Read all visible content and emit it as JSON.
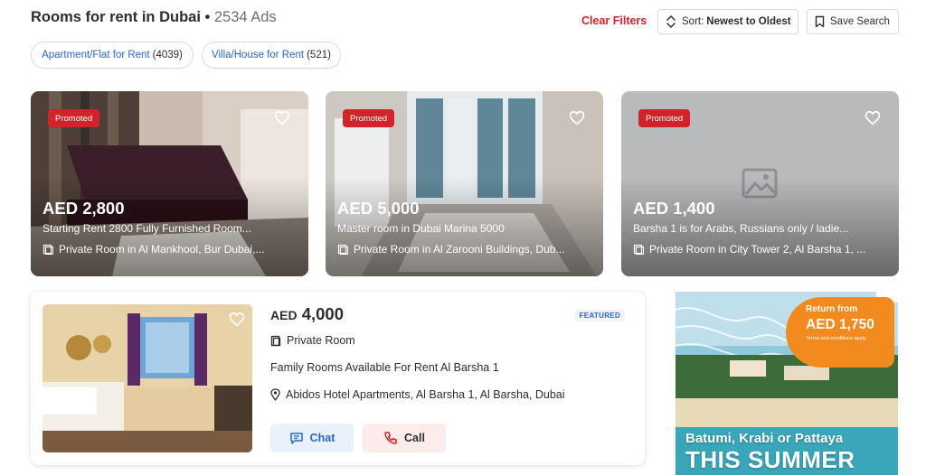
{
  "header": {
    "title": "Rooms for rent in Dubai",
    "separator": " • ",
    "ad_count": "2534 Ads",
    "clear_filters": "Clear Filters",
    "sort_label": "Sort:",
    "sort_value": "Newest to Oldest",
    "save_search": "Save Search"
  },
  "categories": [
    {
      "label": "Apartment/Flat for Rent",
      "count": "(4039)"
    },
    {
      "label": "Villa/House for Rent",
      "count": "(521)"
    }
  ],
  "promoted": [
    {
      "badge": "Promoted",
      "price": "AED 2,800",
      "description": "Starting Rent 2800 Fully Furnished Room...",
      "location": "Private Room in Al Mankhool, Bur Dubai,..."
    },
    {
      "badge": "Promoted",
      "price": "AED 5,000",
      "description": "Master room in Dubai Marina 5000",
      "location": "Private Room in Al Zarooni Buildings, Dub..."
    },
    {
      "badge": "Promoted",
      "price": "AED 1,400",
      "description": "Barsha 1 is for Arabs, Russians only / ladie...",
      "location": "Private Room in City Tower 2, Al Barsha 1, ..."
    }
  ],
  "featured": {
    "currency": "AED",
    "amount": "4,000",
    "badge": "FEATURED",
    "type": "Private Room",
    "description": "Family Rooms Available For Rent Al Barsha 1",
    "location": "Abidos Hotel Apartments, Al Barsha 1, Al Barsha, Dubai",
    "chat_label": "Chat",
    "call_label": "Call"
  },
  "ad": {
    "offer_line1": "Return from",
    "offer_price": "AED 1,750",
    "offer_terms": "Terms and conditions apply",
    "line1": "Batumi, Krabi or Pattaya",
    "line2": "THIS SUMMER"
  },
  "colors": {
    "accent_red": "#d2232a",
    "link_blue": "#2b67c9",
    "ad_orange": "#f28a1e"
  },
  "icons": [
    "sort-icon",
    "bookmark-icon",
    "heart-icon",
    "room-icon",
    "image-placeholder-icon",
    "location-pin-icon",
    "chat-icon",
    "phone-icon"
  ]
}
